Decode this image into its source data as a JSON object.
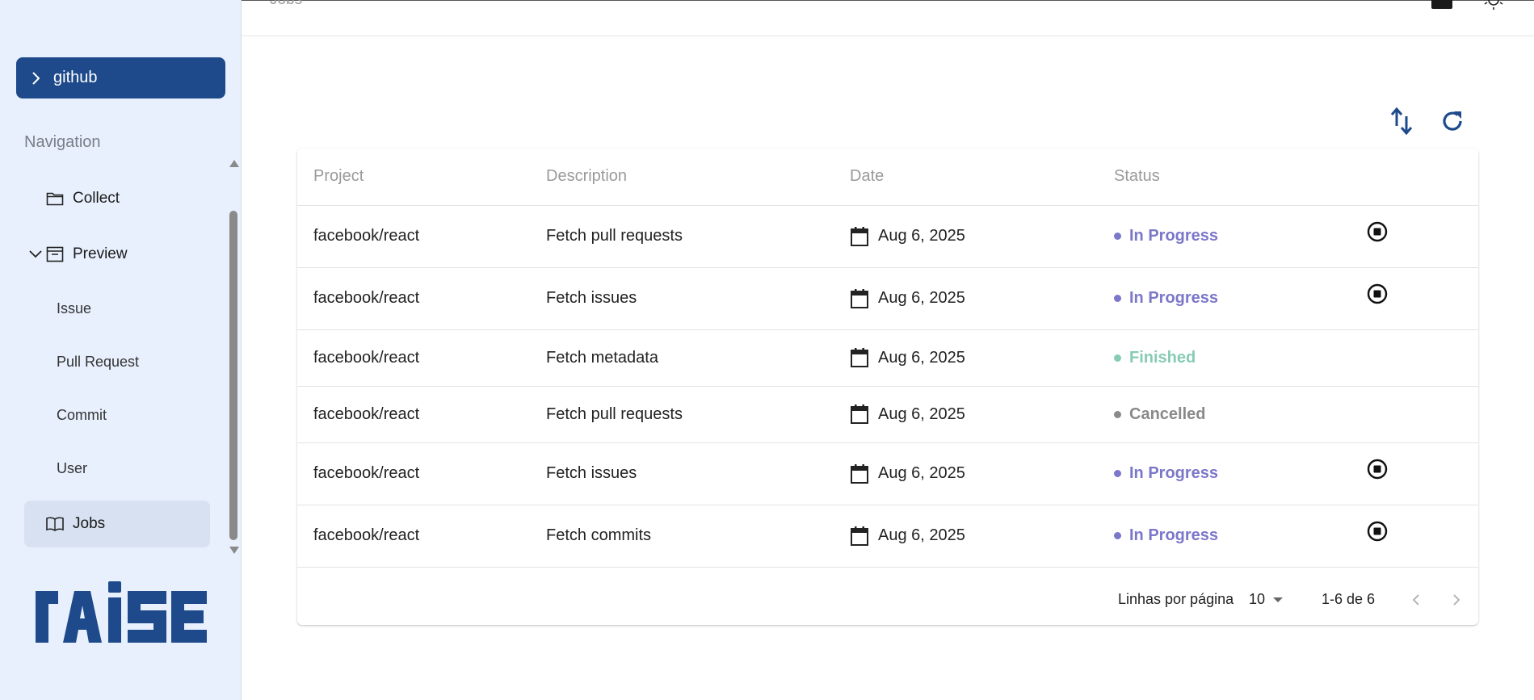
{
  "sidebar": {
    "project": "github",
    "nav_heading": "Navigation",
    "items": [
      {
        "label": "Collect",
        "icon": "folder-icon"
      },
      {
        "label": "Preview",
        "icon": "archive-box-icon"
      },
      {
        "label": "Jobs",
        "icon": "book-open-icon"
      }
    ],
    "sub_items": [
      "Issue",
      "Pull Request",
      "Commit",
      "User"
    ],
    "logo": "rAiSE"
  },
  "topbar": {
    "title": "Jobs"
  },
  "table": {
    "headers": [
      "Project",
      "Description",
      "Date",
      "Status"
    ],
    "rows": [
      {
        "project": "facebook/react",
        "description": "Fetch pull requests",
        "date": "Aug 6, 2025",
        "status": "In Progress",
        "stoppable": true
      },
      {
        "project": "facebook/react",
        "description": "Fetch issues",
        "date": "Aug 6, 2025",
        "status": "In Progress",
        "stoppable": true
      },
      {
        "project": "facebook/react",
        "description": "Fetch metadata",
        "date": "Aug 6, 2025",
        "status": "Finished",
        "stoppable": false
      },
      {
        "project": "facebook/react",
        "description": "Fetch pull requests",
        "date": "Aug 6, 2025",
        "status": "Cancelled",
        "stoppable": false
      },
      {
        "project": "facebook/react",
        "description": "Fetch issues",
        "date": "Aug 6, 2025",
        "status": "In Progress",
        "stoppable": true
      },
      {
        "project": "facebook/react",
        "description": "Fetch commits",
        "date": "Aug 6, 2025",
        "status": "In Progress",
        "stoppable": true
      }
    ]
  },
  "pagination": {
    "rows_per_page_label": "Linhas por página",
    "rows_per_page": "10",
    "range": "1-6 de 6"
  },
  "colors": {
    "brand": "#1e4a8c",
    "in_progress": "#7b77c9",
    "finished": "#86ccb4",
    "cancelled": "#8a8a8a",
    "sidebar_bg": "#e8f0fd"
  }
}
